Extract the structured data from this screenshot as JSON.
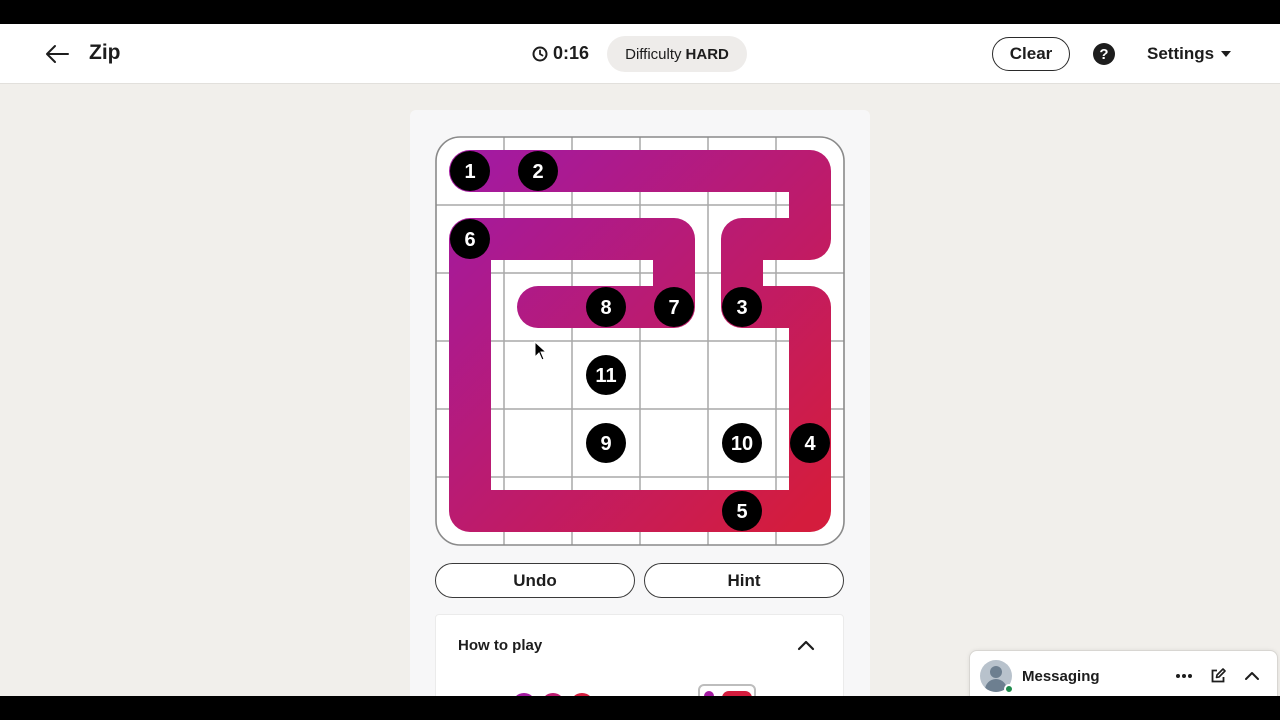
{
  "header": {
    "title": "Zip",
    "timer": "0:16",
    "difficulty_label": "Difficulty",
    "difficulty_value": "HARD",
    "clear_label": "Clear",
    "help_symbol": "?",
    "settings_label": "Settings"
  },
  "board": {
    "rows": 6,
    "cols": 6,
    "path_color_start": "#a31aa0",
    "path_color_end": "#d41c3d",
    "path": [
      [
        0,
        0
      ],
      [
        0,
        1
      ],
      [
        0,
        2
      ],
      [
        0,
        3
      ],
      [
        0,
        4
      ],
      [
        0,
        5
      ],
      [
        1,
        5
      ],
      [
        1,
        4
      ],
      [
        2,
        4
      ],
      [
        2,
        5
      ],
      [
        3,
        5
      ],
      [
        4,
        5
      ],
      [
        5,
        5
      ],
      [
        5,
        4
      ],
      [
        5,
        3
      ],
      [
        5,
        2
      ],
      [
        5,
        1
      ],
      [
        5,
        0
      ],
      [
        4,
        0
      ],
      [
        3,
        0
      ],
      [
        2,
        0
      ],
      [
        1,
        0
      ],
      [
        1,
        1
      ],
      [
        1,
        2
      ],
      [
        1,
        3
      ],
      [
        2,
        3
      ],
      [
        2,
        2
      ],
      [
        2,
        1
      ]
    ],
    "numbers": [
      {
        "label": "1",
        "row": 0,
        "col": 0
      },
      {
        "label": "2",
        "row": 0,
        "col": 1
      },
      {
        "label": "3",
        "row": 2,
        "col": 4
      },
      {
        "label": "4",
        "row": 4,
        "col": 5
      },
      {
        "label": "5",
        "row": 5,
        "col": 4
      },
      {
        "label": "6",
        "row": 1,
        "col": 0
      },
      {
        "label": "7",
        "row": 2,
        "col": 3
      },
      {
        "label": "8",
        "row": 2,
        "col": 2
      },
      {
        "label": "9",
        "row": 4,
        "col": 2
      },
      {
        "label": "10",
        "row": 4,
        "col": 4
      },
      {
        "label": "11",
        "row": 3,
        "col": 2
      }
    ]
  },
  "actions": {
    "undo_label": "Undo",
    "hint_label": "Hint"
  },
  "how_to_play": {
    "title": "How to play"
  },
  "messaging": {
    "label": "Messaging"
  },
  "icons": {
    "back": "arrow-left-icon",
    "timer": "clock-icon",
    "help": "question-circle-icon",
    "settings": "caret-down-icon",
    "collapse": "chevron-up-icon",
    "more": "ellipsis-icon",
    "compose": "compose-icon",
    "minimize": "chevron-up-icon"
  }
}
